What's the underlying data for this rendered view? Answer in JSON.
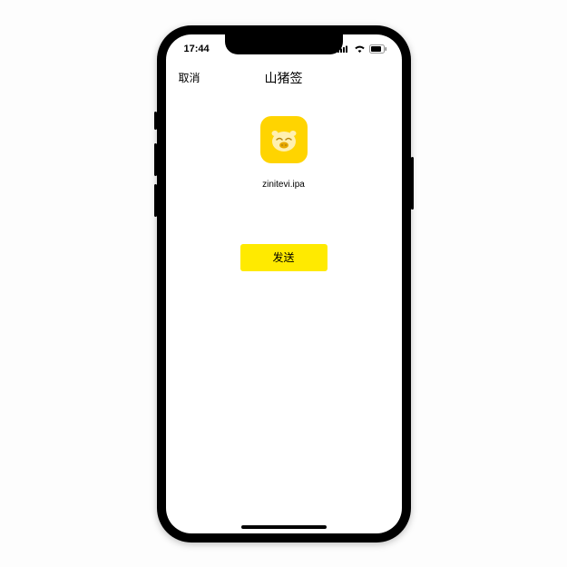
{
  "status": {
    "time": "17:44"
  },
  "nav": {
    "cancel": "取消",
    "title": "山猪签"
  },
  "file": {
    "name": "zinitevi.ipa",
    "icon_name": "pig-app-icon"
  },
  "actions": {
    "send": "发送"
  },
  "colors": {
    "accent": "#ffd400",
    "button": "#ffea00"
  }
}
